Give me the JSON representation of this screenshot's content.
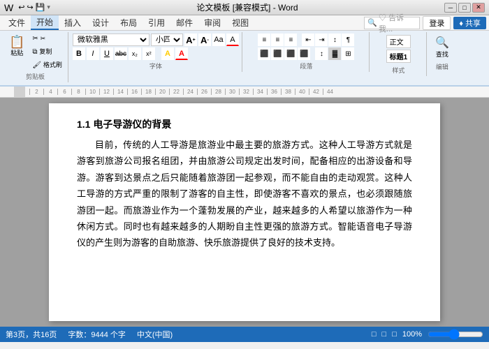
{
  "titleBar": {
    "title": "论文模板 [兼容模式] - Word",
    "appName": "Word",
    "quickAccess": [
      "↩",
      "↪",
      "💾"
    ],
    "winControls": [
      "─",
      "□",
      "✕"
    ]
  },
  "menuBar": {
    "items": [
      "文件",
      "开始",
      "插入",
      "设计",
      "布局",
      "引用",
      "邮件",
      "审阅",
      "视图"
    ],
    "activeItem": "开始",
    "search": "♡ 告诉我...",
    "login": "登录",
    "share": "♦ 共享"
  },
  "ribbon": {
    "clipboard": {
      "label": "剪贴板",
      "paste": "粘贴",
      "cut": "✂",
      "copy": "⧉",
      "formatPainter": "🖌"
    },
    "font": {
      "label": "字体",
      "fontName": "微软雅黑",
      "fontSize": "小四",
      "bold": "B",
      "italic": "I",
      "underline": "U",
      "strikethrough": "abc",
      "subscript": "x₂",
      "superscript": "x²",
      "clearFormat": "A",
      "fontColor": "A",
      "highlight": "A",
      "growFont": "A↑",
      "shrinkFont": "A↓",
      "changeCase": "Aa"
    },
    "paragraph": {
      "label": "段落",
      "bullets": "≡",
      "numbering": "≡",
      "multilevel": "≡",
      "decreaseIndent": "←",
      "increaseIndent": "→",
      "sort": "↕",
      "showMarks": "¶",
      "alignLeft": "≡",
      "alignCenter": "≡",
      "alignRight": "≡",
      "justify": "≡",
      "lineSpacing": "↕",
      "shading": "▓",
      "border": "□"
    },
    "styles": {
      "label": "样式"
    },
    "editing": {
      "label": "编辑"
    }
  },
  "ruler": {
    "marks": [
      "2",
      "4",
      "6",
      "8",
      "10",
      "12",
      "14",
      "16",
      "18",
      "20",
      "22",
      "24",
      "26",
      "28",
      "30",
      "32",
      "34",
      "36",
      "38",
      "40",
      "42",
      "44"
    ]
  },
  "document": {
    "heading": "1.1 电子导游仪的背景",
    "paragraphs": [
      "目前，传统的人工导游是旅游业中最主要的旅游方式。这种人工导游方式就是游客到旅游公司报名组团，并由旅游公司规定出发时间，配备相应的出游设备和导游。游客到达景点之后只能随着旅游团一起参观，而不能自由的走动观赏。这种人工导游的方式严重的限制了游客的自主性，即使游客不喜欢的景点，也必须跟随旅游团一起。而旅游业作为一个蓬勃发展的产业，越来越多的人希望以旅游作为一种休闲方式。同时也有越来越多的人期盼自主性更强的旅游方式。智能语音电子导游仪的产生则为游客的自助旅游、快乐旅游提供了良好的技术支持。"
    ]
  },
  "statusBar": {
    "pages": "第3页，共16页",
    "words": "字数：9444 个字",
    "language": "中文(中国)",
    "viewIcons": [
      "□",
      "□",
      "□"
    ],
    "zoom": "100%"
  }
}
